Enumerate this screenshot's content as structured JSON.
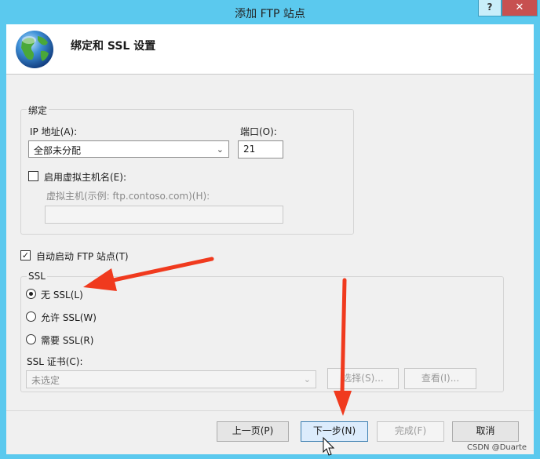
{
  "window": {
    "title": "添加 FTP 站点",
    "help_label": "?",
    "close_label": "✕"
  },
  "header": {
    "title": "绑定和 SSL 设置",
    "icon": "globe-icon"
  },
  "binding": {
    "legend": "绑定",
    "ip_label": "IP 地址(A):",
    "ip_value": "全部未分配",
    "port_label": "端口(O):",
    "port_value": "21",
    "virtual_host_checkbox_label": "启用虚拟主机名(E):",
    "virtual_host_checked": false,
    "virtual_host_label": "虚拟主机(示例: ftp.contoso.com)(H):",
    "virtual_host_value": ""
  },
  "autostart": {
    "label": "自动启动 FTP 站点(T)",
    "checked": true
  },
  "ssl": {
    "legend": "SSL",
    "options": [
      {
        "label": "无 SSL(L)",
        "selected": true
      },
      {
        "label": "允许 SSL(W)",
        "selected": false
      },
      {
        "label": "需要 SSL(R)",
        "selected": false
      }
    ],
    "cert_label": "SSL 证书(C):",
    "cert_value": "未选定",
    "select_button": "选择(S)...",
    "view_button": "查看(I)..."
  },
  "footer": {
    "prev_button": "上一页(P)",
    "next_button": "下一步(N)",
    "finish_button": "完成(F)",
    "cancel_button": "取消"
  },
  "watermark": "CSDN @Duarte",
  "colors": {
    "titlebar": "#5bc9ee",
    "close": "#c75050",
    "annotation_arrow": "#f03a1e"
  }
}
